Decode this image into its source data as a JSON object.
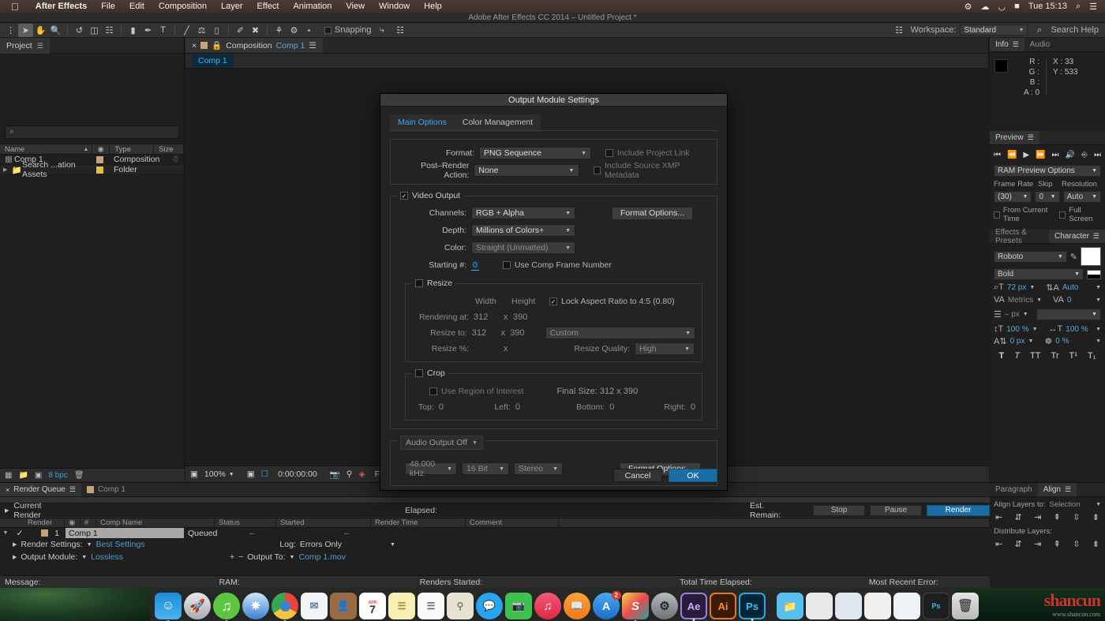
{
  "os_menu": {
    "apple_icon": "apple-icon",
    "items": [
      "After Effects",
      "File",
      "Edit",
      "Composition",
      "Layer",
      "Effect",
      "Animation",
      "View",
      "Window",
      "Help"
    ],
    "status_icons": [
      "dropbox-icon",
      "creative-cloud-icon",
      "wifi-icon",
      "battery-icon"
    ],
    "clock": "Tue 15:13",
    "search_icon": "spotlight-search-icon",
    "notification_icon": "notification-center-icon"
  },
  "window": {
    "title": "Adobe After Effects CC 2014 – Untitled Project *"
  },
  "toolbar": {
    "tools": [
      {
        "name": "selection-tool",
        "glyph": "➤"
      },
      {
        "name": "hand-tool",
        "glyph": "✋"
      },
      {
        "name": "zoom-tool",
        "glyph": "⚲"
      },
      {
        "name": "rotation-tool",
        "glyph": "↺"
      },
      {
        "name": "camera-tool",
        "glyph": "▭"
      },
      {
        "name": "pan-behind-tool",
        "glyph": "⌗"
      },
      {
        "name": "shape-tool",
        "glyph": "■"
      },
      {
        "name": "pen-tool",
        "glyph": "✒"
      },
      {
        "name": "type-tool",
        "glyph": "T"
      },
      {
        "name": "brush-tool",
        "glyph": "╱"
      },
      {
        "name": "clone-stamp-tool",
        "glyph": "⚒"
      },
      {
        "name": "eraser-tool",
        "glyph": "▰"
      },
      {
        "name": "roto-brush-tool",
        "glyph": "✐"
      },
      {
        "name": "puppet-pin-tool",
        "glyph": "✖"
      },
      {
        "name": "puppet-overlap-tool",
        "glyph": "⤴"
      },
      {
        "name": "puppet-starch-tool",
        "glyph": "⤵"
      },
      {
        "name": "puppet-mesh-tool",
        "glyph": "⋈"
      }
    ],
    "snapping_label": "Snapping",
    "snapping_checked": false,
    "workspace_label": "Workspace:",
    "workspace_value": "Standard",
    "search_help_placeholder": "Search Help"
  },
  "project_panel": {
    "tabs": [
      {
        "label": "Project",
        "active": true
      }
    ],
    "search_placeholder": "",
    "columns": [
      "Name",
      "Type",
      "Size"
    ],
    "rows": [
      {
        "name": "Comp 1",
        "type": "Composition",
        "size": "",
        "icon": "composition-icon",
        "color": "#c8a37a"
      },
      {
        "name": "Search ...ation Assets",
        "type": "Folder",
        "size": "",
        "icon": "folder-icon",
        "color": "#e3c13c"
      }
    ],
    "footer": {
      "bit_depth": "8 bpc"
    }
  },
  "comp_panel": {
    "tab_prefix": "Composition",
    "tab_name": "Comp 1",
    "chip_label": "Comp 1",
    "footer": {
      "zoom": "100%",
      "timecode": "0:00:00:00",
      "resolution": "Full"
    }
  },
  "info_panel": {
    "tabs": [
      {
        "label": "Info",
        "active": true
      },
      {
        "label": "Audio",
        "active": false
      }
    ],
    "channels": [
      "R :",
      "G :",
      "B :",
      "A : 0"
    ],
    "x": "X : 33",
    "y": "Y : 533"
  },
  "preview_panel": {
    "tabs": [
      {
        "label": "Preview",
        "active": true
      }
    ],
    "options_label": "RAM Preview Options",
    "frame_rate_label": "Frame Rate",
    "frame_rate_value": "(30)",
    "skip_label": "Skip",
    "skip_value": "0",
    "resolution_label": "Resolution",
    "resolution_value": "Auto",
    "from_current_time": "From Current Time",
    "full_screen": "Full Screen"
  },
  "character_panel": {
    "tabs": [
      {
        "label": "Effects & Presets",
        "active": false
      },
      {
        "label": "Character",
        "active": true
      }
    ],
    "font_family": "Roboto",
    "font_style": "Bold",
    "font_size": "72 px",
    "leading": "Auto",
    "kerning": "Metrics",
    "tracking": "0",
    "stroke_width": "– px",
    "vertical_scale": "100 %",
    "horizontal_scale": "100 %",
    "baseline_shift": "0 px",
    "tsume": "0 %",
    "style_glyphs": [
      "T",
      "T",
      "TT",
      "Tr",
      "T¹",
      "T₁"
    ]
  },
  "align_panel": {
    "tabs": [
      {
        "label": "Paragraph",
        "active": false
      },
      {
        "label": "Align",
        "active": true
      }
    ],
    "align_layers_to_label": "Align Layers to:",
    "align_layers_to_value": "Selection",
    "distribute_label": "Distribute Layers:"
  },
  "render_queue": {
    "tabs": [
      {
        "label": "Render Queue",
        "active": true
      },
      {
        "label": "Comp 1",
        "active": false
      }
    ],
    "current_render_label": "Current Render",
    "elapsed_label": "Elapsed:",
    "est_remain_label": "Est. Remain:",
    "buttons": {
      "stop": "Stop",
      "pause": "Pause",
      "render": "Render"
    },
    "columns": [
      "Render",
      "#",
      "Comp Name",
      "Status",
      "Started",
      "Render Time",
      "Comment"
    ],
    "rows": [
      {
        "checked": true,
        "index": "1",
        "comp_name": "Comp 1",
        "status": "Queued",
        "started": "–",
        "render_time": "–",
        "comment": ""
      }
    ],
    "render_settings_label": "Render Settings:",
    "render_settings_value": "Best Settings",
    "log_label": "Log:",
    "log_value": "Errors Only",
    "output_module_label": "Output Module:",
    "output_module_value": "Lossless",
    "output_to_label": "Output To:",
    "output_to_value": "Comp 1.mov",
    "footer": {
      "message": "Message:",
      "ram": "RAM:",
      "renders_started": "Renders Started:",
      "total_time_elapsed": "Total Time Elapsed:",
      "most_recent_error": "Most Recent Error:"
    }
  },
  "dialog": {
    "title": "Output Module Settings",
    "tabs": [
      {
        "label": "Main Options",
        "active": true
      },
      {
        "label": "Color Management",
        "active": false
      }
    ],
    "format_label": "Format:",
    "format_value": "PNG Sequence",
    "post_render_label": "Post–Render Action:",
    "post_render_value": "None",
    "include_project_link": "Include Project Link",
    "include_project_link_checked": false,
    "include_xmp": "Include Source XMP Metadata",
    "include_xmp_checked": false,
    "video_output_label": "Video Output",
    "video_output_checked": true,
    "channels_label": "Channels:",
    "channels_value": "RGB + Alpha",
    "depth_label": "Depth:",
    "depth_value": "Millions of Colors+",
    "color_label": "Color:",
    "color_value": "Straight (Unmatted)",
    "starting_num_label": "Starting #:",
    "starting_num_value": "0",
    "use_comp_frame_number": "Use Comp Frame Number",
    "use_comp_frame_number_checked": false,
    "format_options_button": "Format Options...",
    "resize_label": "Resize",
    "resize_checked": false,
    "width_label": "Width",
    "height_label": "Height",
    "lock_aspect_label": "Lock Aspect Ratio to 4:5 (0.80)",
    "lock_aspect_checked": true,
    "rendering_at_label": "Rendering at:",
    "rendering_at_width": "312",
    "rendering_at_height": "390",
    "resize_to_label": "Resize to:",
    "resize_to_width": "312",
    "resize_to_height": "390",
    "resize_preset": "Custom",
    "resize_pct_label": "Resize %:",
    "resize_quality_label": "Resize Quality:",
    "resize_quality_value": "High",
    "crop_label": "Crop",
    "crop_checked": false,
    "use_roi_label": "Use Region of Interest",
    "use_roi_checked": false,
    "final_size_label": "Final Size: 312 x 390",
    "top_label": "Top:",
    "top_value": "0",
    "left_label": "Left:",
    "left_value": "0",
    "bottom_label": "Bottom:",
    "bottom_value": "0",
    "right_label": "Right:",
    "right_value": "0",
    "audio_output_label": "Audio Output Off",
    "sample_rate": "48.000 kHz",
    "bit_depth": "16 Bit",
    "channels_audio": "Stereo",
    "audio_format_options_button": "Format Options...",
    "cancel_button": "Cancel",
    "ok_button": "OK",
    "accent_color": "#1a6ea5"
  },
  "dock": {
    "items": [
      {
        "name": "finder-icon",
        "label": "",
        "bg": "#2a9de0",
        "glyph": "🙂",
        "running": true
      },
      {
        "name": "launchpad-icon",
        "label": "",
        "bg": "#b9bcc0",
        "glyph": "🚀",
        "running": false
      },
      {
        "name": "spotify-icon",
        "label": "",
        "bg": "#64c73f",
        "glyph": "♫",
        "running": true
      },
      {
        "name": "safari-icon",
        "label": "",
        "bg": "#2f7fd4",
        "glyph": "⦿",
        "running": false
      },
      {
        "name": "chrome-icon",
        "label": "",
        "bg": "#e8453c",
        "glyph": "◉",
        "running": true
      },
      {
        "name": "mail-icon",
        "label": "",
        "bg": "#eceff4",
        "glyph": "✉",
        "running": false
      },
      {
        "name": "contacts-icon",
        "label": "",
        "bg": "#9a6a42",
        "glyph": "👤",
        "running": false
      },
      {
        "name": "calendar-icon",
        "label": "7",
        "bg": "#f5f5f5",
        "glyph": "",
        "running": false
      },
      {
        "name": "notes-icon",
        "label": "",
        "bg": "#f6e9ac",
        "glyph": "≡",
        "running": false
      },
      {
        "name": "reminders-icon",
        "label": "",
        "bg": "#fafafa",
        "glyph": "☰",
        "running": false
      },
      {
        "name": "maps-icon",
        "label": "",
        "bg": "#e6e3d2",
        "glyph": "⌖",
        "running": false
      },
      {
        "name": "messages-icon",
        "label": "",
        "bg": "#2aa3f0",
        "glyph": "💬",
        "running": false
      },
      {
        "name": "facetime-icon",
        "label": "",
        "bg": "#3fc14f",
        "glyph": "📹",
        "running": false
      },
      {
        "name": "itunes-icon",
        "label": "",
        "bg": "#ec4257",
        "glyph": "♫",
        "running": false
      },
      {
        "name": "ibooks-icon",
        "label": "",
        "bg": "#f28b2c",
        "glyph": "📖",
        "running": false
      },
      {
        "name": "app-store-icon",
        "label": "",
        "bg": "#2a86e8",
        "glyph": "A",
        "badge": "2",
        "running": false
      },
      {
        "name": "sketch-icon",
        "label": "S",
        "bg": "#e8494d",
        "glyph": "",
        "running": true
      },
      {
        "name": "system-preferences-icon",
        "label": "",
        "bg": "#848484",
        "glyph": "⚙",
        "running": false
      },
      {
        "name": "after-effects-icon",
        "label": "Ae",
        "bg": "#2b1b3d",
        "glyph": "",
        "running": true
      },
      {
        "name": "illustrator-icon",
        "label": "Ai",
        "bg": "#3b1b08",
        "glyph": "",
        "running": false
      },
      {
        "name": "photoshop-icon",
        "label": "Ps",
        "bg": "#062536",
        "glyph": "",
        "running": true
      }
    ],
    "minimized": [
      {
        "name": "downloads-folder-icon",
        "bg": "#57c0f0",
        "glyph": "📁"
      },
      {
        "name": "minimized-window-1",
        "bg": "#e8e8e8",
        "glyph": ""
      },
      {
        "name": "minimized-window-2",
        "bg": "#dfe6ee",
        "glyph": ""
      },
      {
        "name": "minimized-window-3",
        "bg": "#f0f0f0",
        "glyph": ""
      },
      {
        "name": "minimized-window-4",
        "bg": "#eef2f6",
        "glyph": ""
      },
      {
        "name": "minimized-window-5",
        "bg": "#1e1e1e",
        "glyph": ""
      }
    ],
    "trash": {
      "name": "trash-icon",
      "glyph": "🗑"
    }
  },
  "watermark": {
    "text": "shancun",
    "sub": "www.shancun.com"
  }
}
